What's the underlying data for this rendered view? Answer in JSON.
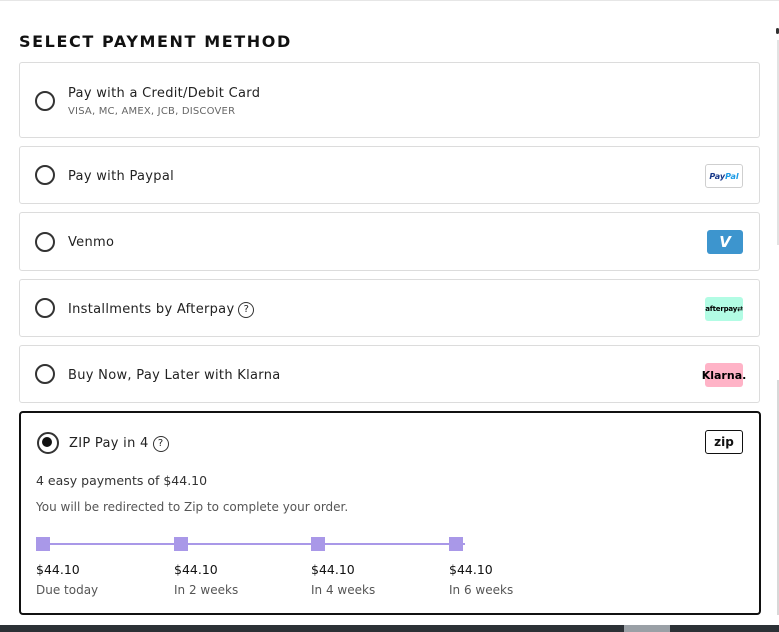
{
  "title": "SELECT PAYMENT METHOD",
  "options": [
    {
      "label": "Pay with a Credit/Debit Card",
      "sub": "VISA, MC, AMEX, JCB, DISCOVER"
    },
    {
      "label": "Pay with Paypal",
      "logo": {
        "a": "Pay",
        "b": "Pal"
      }
    },
    {
      "label": "Venmo",
      "logo": "V"
    },
    {
      "label": "Installments by Afterpay",
      "help": "?",
      "logo": "afterpay⇄"
    },
    {
      "label": "Buy Now, Pay Later with Klarna",
      "logo": "Klarna."
    }
  ],
  "zip": {
    "label": "ZIP Pay in 4",
    "help": "?",
    "logo": "zip",
    "summary": "4 easy payments of $44.10",
    "note": "You will be redirected to Zip to complete your order.",
    "payments": [
      {
        "amount": "$44.10",
        "when": "Due today"
      },
      {
        "amount": "$44.10",
        "when": "In 2 weeks"
      },
      {
        "amount": "$44.10",
        "when": "In 4 weeks"
      },
      {
        "amount": "$44.10",
        "when": "In 6 weeks"
      }
    ]
  },
  "colors": {
    "zip_accent": "#a998e8",
    "venmo": "#3d95ce",
    "afterpay": "#b2fce4",
    "klarna": "#ffb3c7"
  }
}
